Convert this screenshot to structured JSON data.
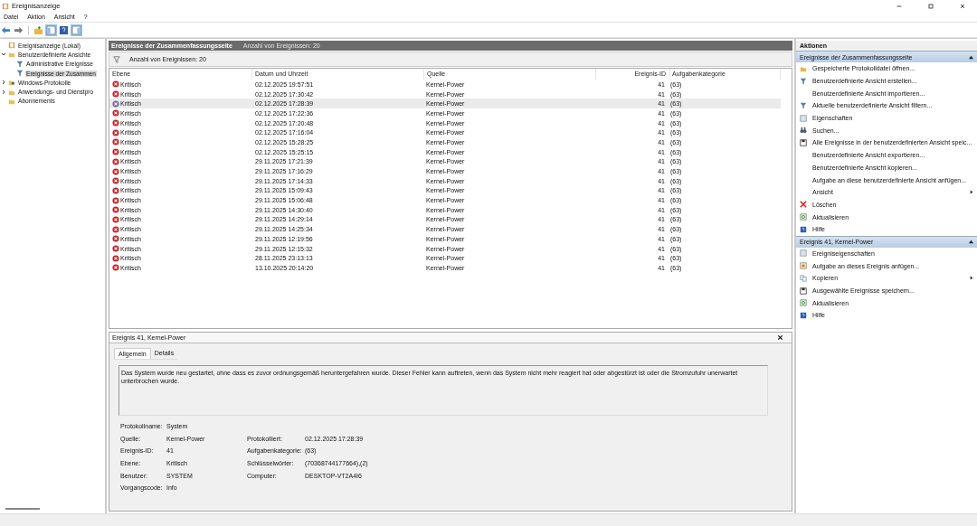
{
  "window": {
    "title": "Ereignisanzeige"
  },
  "menu": [
    "Datei",
    "Aktion",
    "Ansicht",
    "?"
  ],
  "tree": [
    {
      "label": "Ereignisanzeige (Lokal)",
      "kind": "root",
      "selected": false
    },
    {
      "label": "Benutzerdefinierte Ansichte",
      "kind": "folder",
      "expanded": true,
      "selected": false,
      "children": [
        {
          "label": "Administrative Ereignisse",
          "kind": "filter",
          "selected": false
        },
        {
          "label": "Ereignisse der Zusammen",
          "kind": "filter",
          "selected": true
        }
      ]
    },
    {
      "label": "Windows-Protokolle",
      "kind": "logfolder",
      "expanded": false,
      "selected": false
    },
    {
      "label": "Anwendungs- und Dienstpro",
      "kind": "folder",
      "expanded": false,
      "selected": false
    },
    {
      "label": "Abonnements",
      "kind": "folder",
      "selected": false
    }
  ],
  "view": {
    "title": "Ereignisse der Zusammenfassungsseite",
    "count": "Anzahl von Ereignissen: 20",
    "filter_text": "Anzahl von Ereignissen: 20"
  },
  "table": {
    "columns": [
      "Ebene",
      "Datum und Uhrzeit",
      "Quelle",
      "Ereignis-ID",
      "Aufgabenkategorie"
    ],
    "rows": [
      {
        "level": "Kritisch",
        "date": "02.12.2025 19:57:51",
        "source": "Kernel-Power",
        "id": "41",
        "category": "(63)",
        "selected": false
      },
      {
        "level": "Kritisch",
        "date": "02.12.2025 17:30:42",
        "source": "Kernel-Power",
        "id": "41",
        "category": "(63)",
        "selected": false
      },
      {
        "level": "Kritisch",
        "date": "02.12.2025 17:28:39",
        "source": "Kernel-Power",
        "id": "41",
        "category": "(63)",
        "selected": true
      },
      {
        "level": "Kritisch",
        "date": "02.12.2025 17:22:36",
        "source": "Kernel-Power",
        "id": "41",
        "category": "(63)",
        "selected": false
      },
      {
        "level": "Kritisch",
        "date": "02.12.2025 17:20:48",
        "source": "Kernel-Power",
        "id": "41",
        "category": "(63)",
        "selected": false
      },
      {
        "level": "Kritisch",
        "date": "02.12.2025 17:16:04",
        "source": "Kernel-Power",
        "id": "41",
        "category": "(63)",
        "selected": false
      },
      {
        "level": "Kritisch",
        "date": "02.12.2025 15:28:25",
        "source": "Kernel-Power",
        "id": "41",
        "category": "(63)",
        "selected": false
      },
      {
        "level": "Kritisch",
        "date": "02.12.2025 15:25:15",
        "source": "Kernel-Power",
        "id": "41",
        "category": "(63)",
        "selected": false
      },
      {
        "level": "Kritisch",
        "date": "29.11.2025 17:21:39",
        "source": "Kernel-Power",
        "id": "41",
        "category": "(63)",
        "selected": false
      },
      {
        "level": "Kritisch",
        "date": "29.11.2025 17:16:29",
        "source": "Kernel-Power",
        "id": "41",
        "category": "(63)",
        "selected": false
      },
      {
        "level": "Kritisch",
        "date": "29.11.2025 17:14:33",
        "source": "Kernel-Power",
        "id": "41",
        "category": "(63)",
        "selected": false
      },
      {
        "level": "Kritisch",
        "date": "29.11.2025 15:09:43",
        "source": "Kernel-Power",
        "id": "41",
        "category": "(63)",
        "selected": false
      },
      {
        "level": "Kritisch",
        "date": "29.11.2025 15:06:48",
        "source": "Kernel-Power",
        "id": "41",
        "category": "(63)",
        "selected": false
      },
      {
        "level": "Kritisch",
        "date": "29.11.2025 14:30:40",
        "source": "Kernel-Power",
        "id": "41",
        "category": "(63)",
        "selected": false
      },
      {
        "level": "Kritisch",
        "date": "29.11.2025 14:29:14",
        "source": "Kernel-Power",
        "id": "41",
        "category": "(63)",
        "selected": false
      },
      {
        "level": "Kritisch",
        "date": "29.11.2025 14:25:34",
        "source": "Kernel-Power",
        "id": "41",
        "category": "(63)",
        "selected": false
      },
      {
        "level": "Kritisch",
        "date": "29.11.2025 12:19:56",
        "source": "Kernel-Power",
        "id": "41",
        "category": "(63)",
        "selected": false
      },
      {
        "level": "Kritisch",
        "date": "29.11.2025 12:15:32",
        "source": "Kernel-Power",
        "id": "41",
        "category": "(63)",
        "selected": false
      },
      {
        "level": "Kritisch",
        "date": "28.11.2025 23:13:13",
        "source": "Kernel-Power",
        "id": "41",
        "category": "(63)",
        "selected": false
      },
      {
        "level": "Kritisch",
        "date": "13.10.2025 20:14:20",
        "source": "Kernel-Power",
        "id": "41",
        "category": "(63)",
        "selected": false
      }
    ]
  },
  "detail": {
    "title": "Ereignis 41, Kernel-Power",
    "tabs": [
      {
        "label": "Allgemein",
        "selected": true
      },
      {
        "label": "Details",
        "selected": false
      }
    ],
    "description": "Das System wurde neu gestartet, ohne dass es zuvor ordnungsgemäß heruntergefahren wurde. Dieser Fehler kann auftreten, wenn das System nicht mehr reagiert hat oder abgestürzt ist oder die Stromzufuhr unerwartet unterbrochen wurde.",
    "fields": [
      {
        "label": "Protokollname:",
        "value": "System"
      },
      {
        "label": "Quelle:",
        "value": "Kernel-Power",
        "label_2": "Protokolliert:",
        "value_2": "02.12.2025 17:28:39"
      },
      {
        "label": "Ereignis-ID:",
        "value": "41",
        "label_2": "Aufgabenkategorie:",
        "value_2": "(63)"
      },
      {
        "label": "Ebene:",
        "value": "Kritisch",
        "label_2": "Schlüsselwörter:",
        "value_2": "(70368744177664),(2)"
      },
      {
        "label": "Benutzer:",
        "value": "SYSTEM",
        "label_2": "Computer:",
        "value_2": "DESKTOP-VT2A4I6"
      },
      {
        "label": "Vorgangscode:",
        "value": "Info"
      }
    ]
  },
  "actions": {
    "title": "Aktionen",
    "sections": [
      {
        "title": "Ereignisse der Zusammenfassungsseite",
        "items": [
          {
            "label": "Gespeicherte Protokolldatei öffnen...",
            "kind": "folder",
            "submenu": false
          },
          {
            "label": "Benutzerdefinierte Ansicht erstellen...",
            "kind": "filter",
            "submenu": false
          },
          {
            "label": "Benutzerdefinierte Ansicht importieren...",
            "kind": "none",
            "submenu": false
          },
          {
            "label": "Aktuelle benutzerdefinierte Ansicht filtern...",
            "kind": "filter",
            "submenu": false
          },
          {
            "label": "Eigenschaften",
            "kind": "properties",
            "submenu": false
          },
          {
            "label": "Suchen...",
            "kind": "search",
            "submenu": false
          },
          {
            "label": "Alle Ereignisse in der benutzerdefinierten Ansicht speic...",
            "kind": "save",
            "submenu": false
          },
          {
            "label": "Benutzerdefinierte Ansicht exportieren...",
            "kind": "none",
            "submenu": false
          },
          {
            "label": "Benutzerdefinierte Ansicht kopieren...",
            "kind": "none",
            "submenu": false
          },
          {
            "label": "Aufgabe an diese benutzerdefinierte Ansicht anfügen...",
            "kind": "none",
            "submenu": false
          },
          {
            "label": "Ansicht",
            "kind": "none",
            "submenu": true
          },
          {
            "label": "Löschen",
            "kind": "delete",
            "submenu": false
          },
          {
            "label": "Aktualisieren",
            "kind": "refresh",
            "submenu": false
          },
          {
            "label": "Hilfe",
            "kind": "help",
            "submenu": false
          }
        ]
      },
      {
        "title": "Ereignis 41, Kernel-Power",
        "items": [
          {
            "label": "Ereigniseigenschaften",
            "kind": "properties",
            "submenu": false
          },
          {
            "label": "Aufgabe an dieses Ereignis anfügen...",
            "kind": "task",
            "submenu": false
          },
          {
            "label": "Kopieren",
            "kind": "copy",
            "submenu": true
          },
          {
            "label": "Ausgewählte Ereignisse speichern...",
            "kind": "save",
            "submenu": false
          },
          {
            "label": "Aktualisieren",
            "kind": "refresh",
            "submenu": false
          },
          {
            "label": "Hilfe",
            "kind": "help",
            "submenu": false
          }
        ]
      }
    ]
  }
}
